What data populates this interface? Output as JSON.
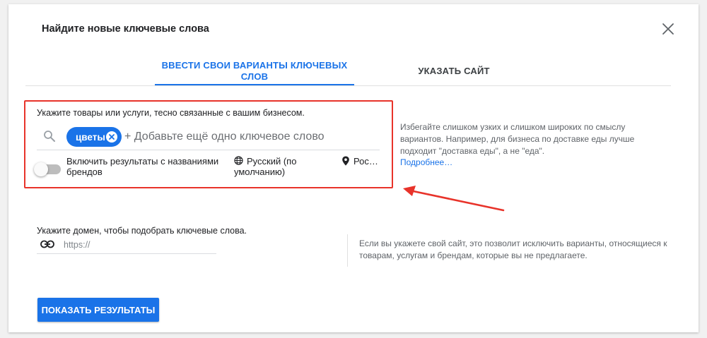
{
  "dialog": {
    "title": "Найдите новые ключевые слова"
  },
  "tabs": [
    {
      "label": "ВВЕСТИ СВОИ ВАРИАНТЫ КЛЮЧЕВЫХ СЛОВ",
      "active": true
    },
    {
      "label": "УКАЗАТЬ САЙТ",
      "active": false
    }
  ],
  "keywords": {
    "prompt": "Укажите товары или услуги, тесно связанные с вашим бизнесом.",
    "chips": [
      {
        "label": "цветы"
      }
    ],
    "add_placeholder": "+ Добавьте ещё одно ключевое слово",
    "brand_toggle_label": "Включить результаты с названиями брендов",
    "brand_toggle_on": false,
    "language": "Русский (по умолчанию)",
    "location": "Рос…",
    "hint": "Избегайте слишком узких и слишком широких по смыслу вариантов. Например, для бизнеса по доставке еды лучше подходит \"доставка еды\", а не \"еда\".",
    "more_link": "Подробнее…"
  },
  "domain": {
    "label": "Укажите домен, чтобы подобрать ключевые слова.",
    "placeholder": "https://",
    "hint": "Если вы укажете свой сайт, это позволит исключить варианты, относящиеся к товарам, услугам и брендам, которые вы не предлагаете."
  },
  "submit_label": "ПОКАЗАТЬ РЕЗУЛЬТАТЫ",
  "icons": {
    "close": "close-icon",
    "search": "search-icon",
    "chip_remove": "cancel-circle-icon",
    "language": "globe-icon",
    "location": "location-pin-icon",
    "link": "link-icon",
    "annotation": "red-arrow-icon"
  },
  "colors": {
    "accent": "#1a73e8",
    "annotation": "#e8332a",
    "text": "#202124",
    "muted": "#5f6368"
  }
}
